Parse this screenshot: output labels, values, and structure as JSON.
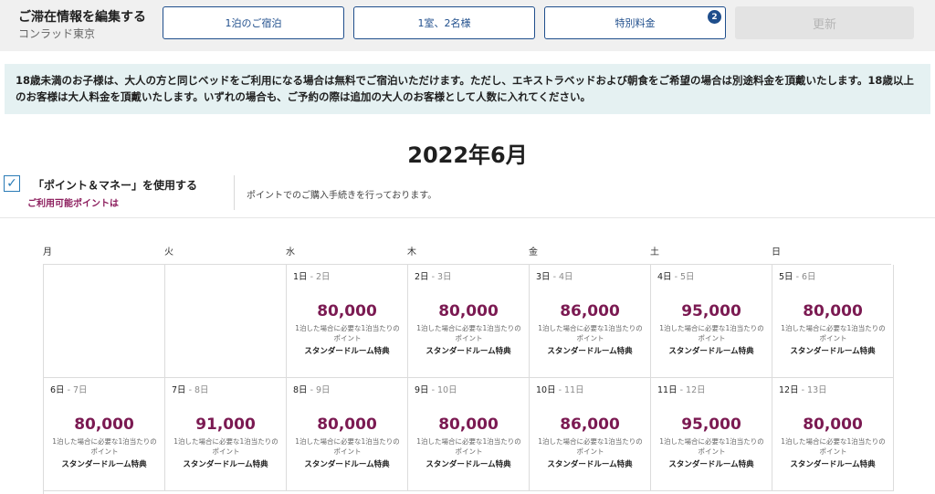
{
  "header": {
    "edit_title": "ご滞在情報を編集する",
    "hotel_name": "コンラッド東京",
    "nights_label": "1泊のご宿泊",
    "rooms_label": "1室、2名様",
    "rates_label": "特別料金",
    "rates_badge": "2",
    "update_label": "更新"
  },
  "banner": {
    "text": "18歳未満のお子様は、大人の方と同じベッドをご利用になる場合は無料でご宿泊いただけます。ただし、エキストラベッドおよび朝食をご希望の場合は別途料金を頂戴いたします。18歳以上のお客様は大人料金を頂戴いたします。いずれの場合も、ご予約の際は追加の大人のお客様として人数に入れてください。"
  },
  "month_title": "2022年6月",
  "points_money": {
    "label": "「ポイント＆マネー」を使用する",
    "available_points": "ご利用可能ポイントは",
    "notice": "ポイントでのご購入手続きを行っております。",
    "checked": true
  },
  "weekdays": [
    "月",
    "火",
    "水",
    "木",
    "金",
    "土",
    "日"
  ],
  "calendar": [
    {
      "empty": true
    },
    {
      "empty": true
    },
    {
      "from": "1日",
      "to": " - 2日",
      "points": "80,000",
      "note": "1泊した場合に必要な1泊当たりのポイント",
      "room": "スタンダードルーム特典"
    },
    {
      "from": "2日",
      "to": " - 3日",
      "points": "80,000",
      "note": "1泊した場合に必要な1泊当たりのポイント",
      "room": "スタンダードルーム特典"
    },
    {
      "from": "3日",
      "to": " - 4日",
      "points": "86,000",
      "note": "1泊した場合に必要な1泊当たりのポイント",
      "room": "スタンダードルーム特典"
    },
    {
      "from": "4日",
      "to": " - 5日",
      "points": "95,000",
      "note": "1泊した場合に必要な1泊当たりのポイント",
      "room": "スタンダードルーム特典"
    },
    {
      "from": "5日",
      "to": " - 6日",
      "points": "80,000",
      "note": "1泊した場合に必要な1泊当たりのポイント",
      "room": "スタンダードルーム特典"
    },
    {
      "from": "6日",
      "to": " - 7日",
      "points": "80,000",
      "note": "1泊した場合に必要な1泊当たりのポイント",
      "room": "スタンダードルーム特典"
    },
    {
      "from": "7日",
      "to": " - 8日",
      "points": "91,000",
      "note": "1泊した場合に必要な1泊当たりのポイント",
      "room": "スタンダードルーム特典"
    },
    {
      "from": "8日",
      "to": " - 9日",
      "points": "80,000",
      "note": "1泊した場合に必要な1泊当たりのポイント",
      "room": "スタンダードルーム特典"
    },
    {
      "from": "9日",
      "to": " - 10日",
      "points": "80,000",
      "note": "1泊した場合に必要な1泊当たりのポイント",
      "room": "スタンダードルーム特典"
    },
    {
      "from": "10日",
      "to": " - 11日",
      "points": "86,000",
      "note": "1泊した場合に必要な1泊当たりのポイント",
      "room": "スタンダードルーム特典"
    },
    {
      "from": "11日",
      "to": " - 12日",
      "points": "95,000",
      "note": "1泊した場合に必要な1泊当たりのポイント",
      "room": "スタンダードルーム特典"
    },
    {
      "from": "12日",
      "to": " - 13日",
      "points": "80,000",
      "note": "1泊した場合に必要な1泊当たりのポイント",
      "room": "スタンダードルーム特典"
    }
  ]
}
